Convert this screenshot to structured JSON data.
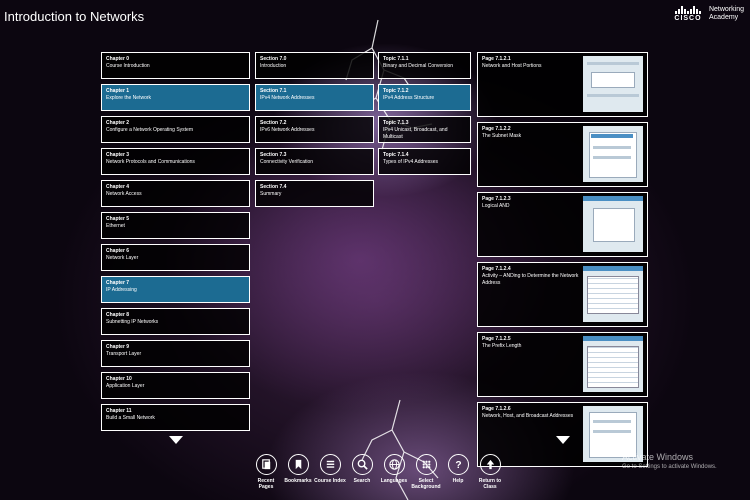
{
  "header": {
    "title": "Introduction to Networks",
    "logo": {
      "brand": "CISCO",
      "line1": "Networking",
      "line2": "Academy"
    }
  },
  "chapters": [
    {
      "num": "Chapter 0",
      "label": "Course Introduction",
      "active": false
    },
    {
      "num": "Chapter 1",
      "label": "Explore the Network",
      "active": true
    },
    {
      "num": "Chapter 2",
      "label": "Configure a Network Operating System",
      "active": false
    },
    {
      "num": "Chapter 3",
      "label": "Network Protocols and Communications",
      "active": false
    },
    {
      "num": "Chapter 4",
      "label": "Network Access",
      "active": false
    },
    {
      "num": "Chapter 5",
      "label": "Ethernet",
      "active": false
    },
    {
      "num": "Chapter 6",
      "label": "Network Layer",
      "active": false
    },
    {
      "num": "Chapter 7",
      "label": "IP Addressing",
      "active": true
    },
    {
      "num": "Chapter 8",
      "label": "Subnetting IP Networks",
      "active": false
    },
    {
      "num": "Chapter 9",
      "label": "Transport Layer",
      "active": false
    },
    {
      "num": "Chapter 10",
      "label": "Application Layer",
      "active": false
    },
    {
      "num": "Chapter 11",
      "label": "Build a Small Network",
      "active": false
    }
  ],
  "sections": [
    {
      "num": "Section 7.0",
      "label": "Introduction",
      "active": false
    },
    {
      "num": "Section 7.1",
      "label": "IPv4 Network Addresses",
      "active": true
    },
    {
      "num": "Section 7.2",
      "label": "IPv6 Network Addresses",
      "active": false
    },
    {
      "num": "Section 7.3",
      "label": "Connectivity Verification",
      "active": false
    },
    {
      "num": "Section 7.4",
      "label": "Summary",
      "active": false
    }
  ],
  "topics": [
    {
      "num": "Topic 7.1.1",
      "label": "Binary and Decimal Conversion",
      "active": false
    },
    {
      "num": "Topic 7.1.2",
      "label": "IPv4 Address Structure",
      "active": true
    },
    {
      "num": "Topic 7.1.3",
      "label": "IPv4 Unicast, Broadcast, and Multicast",
      "active": false
    },
    {
      "num": "Topic 7.1.4",
      "label": "Types of IPv4 Addresses",
      "active": false
    }
  ],
  "pages": [
    {
      "num": "Page 7.1.2.1",
      "label": "Network and Host Portions"
    },
    {
      "num": "Page 7.1.2.2",
      "label": "The Subnet Mask"
    },
    {
      "num": "Page 7.1.2.3",
      "label": "Logical AND"
    },
    {
      "num": "Page 7.1.2.4",
      "label": "Activity – ANDing to Determine the Network Address"
    },
    {
      "num": "Page 7.1.2.5",
      "label": "The Prefix Length"
    },
    {
      "num": "Page 7.1.2.6",
      "label": "Network, Host, and Broadcast Addresses"
    }
  ],
  "toolbar": [
    {
      "label": "Recent Pages",
      "icon": "recent-pages-icon"
    },
    {
      "label": "Bookmarks",
      "icon": "bookmark-icon"
    },
    {
      "label": "Course Index",
      "icon": "list-icon"
    },
    {
      "label": "Search",
      "icon": "search-icon"
    },
    {
      "label": "Languages",
      "icon": "globe-icon"
    },
    {
      "label": "Select Background",
      "icon": "grid-icon"
    },
    {
      "label": "Help",
      "icon": "help-icon"
    },
    {
      "label": "Return to Class",
      "icon": "arrow-up-icon"
    }
  ],
  "watermark": {
    "title": "Activate Windows",
    "subtitle": "Go to Settings to activate Windows."
  },
  "colors": {
    "active": "#1c6b92",
    "item_bg": "#000000",
    "border": "#ffffff"
  }
}
